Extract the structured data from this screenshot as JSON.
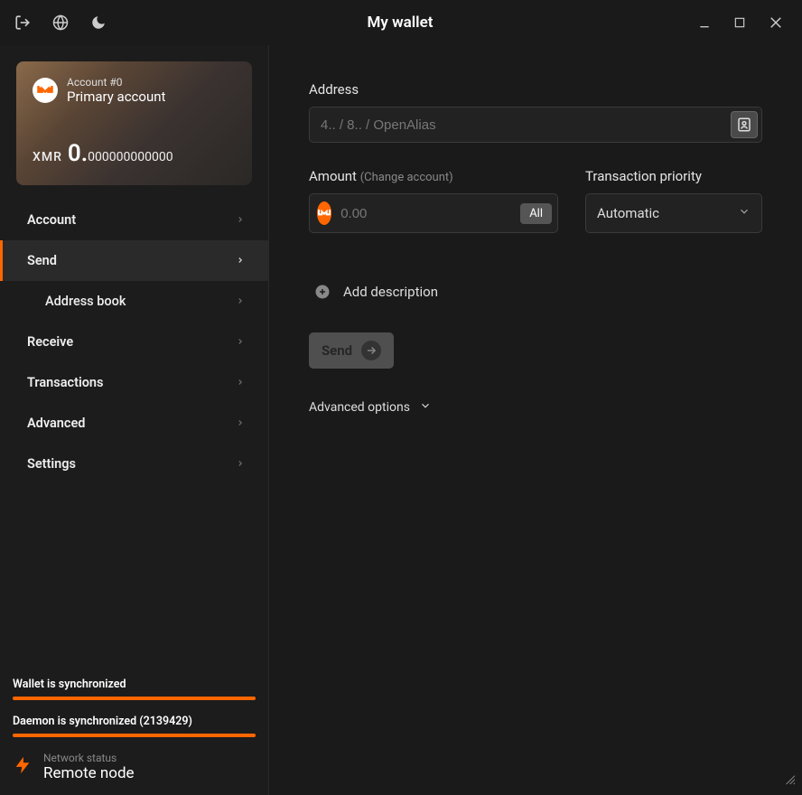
{
  "titlebar": {
    "title": "My wallet"
  },
  "account": {
    "tag": "Account #0",
    "name": "Primary account",
    "currency": "XMR",
    "balance_int": "0.",
    "balance_frac": "000000000000"
  },
  "nav": {
    "items": [
      {
        "label": "Account"
      },
      {
        "label": "Send"
      },
      {
        "label": "Address book"
      },
      {
        "label": "Receive"
      },
      {
        "label": "Transactions"
      },
      {
        "label": "Advanced"
      },
      {
        "label": "Settings"
      }
    ]
  },
  "sync": {
    "wallet_label": "Wallet is synchronized",
    "daemon_label": "Daemon is synchronized (2139429)"
  },
  "network": {
    "label": "Network status",
    "value": "Remote node"
  },
  "send": {
    "address_label": "Address",
    "address_placeholder": "4.. / 8.. / OpenAlias",
    "amount_label": "Amount",
    "amount_sublabel": "(Change account)",
    "amount_placeholder": "0.00",
    "all_button": "All",
    "priority_label": "Transaction priority",
    "priority_value": "Automatic",
    "add_description": "Add description",
    "send_button": "Send",
    "advanced_options": "Advanced options"
  }
}
